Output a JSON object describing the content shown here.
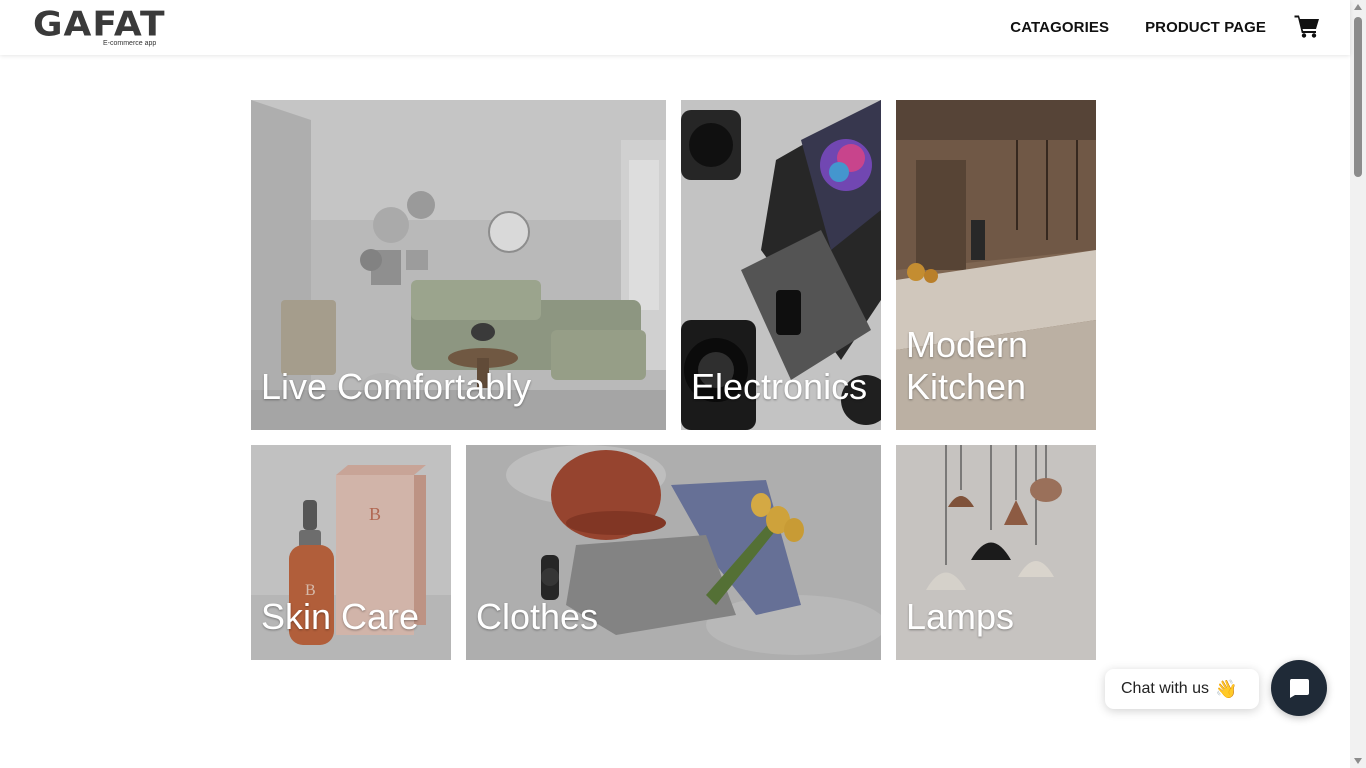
{
  "header": {
    "logo_text": "GAFAT",
    "logo_subtitle": "E-commerce app",
    "nav": [
      {
        "label": "CATAGORIES"
      },
      {
        "label": "PRODUCT PAGE"
      }
    ],
    "cart_icon": "shopping-cart-icon"
  },
  "categories": [
    {
      "label": "Live Comfortably",
      "image": "living-room"
    },
    {
      "label": "Electronics",
      "image": "camera-laptop"
    },
    {
      "label": "Modern\nKitchen",
      "image": "kitchen"
    },
    {
      "label": "Skin Care",
      "image": "serum-bottle"
    },
    {
      "label": "Clothes",
      "image": "clothes-flatlay"
    },
    {
      "label": "Lamps",
      "image": "pendant-lamps"
    }
  ],
  "chat": {
    "label": "Chat with us",
    "emoji": "👋",
    "button_icon": "chat-icon"
  },
  "colors": {
    "chat_button": "#1f2a37",
    "nav_text": "#111111",
    "logo": "#3a3a3a"
  }
}
